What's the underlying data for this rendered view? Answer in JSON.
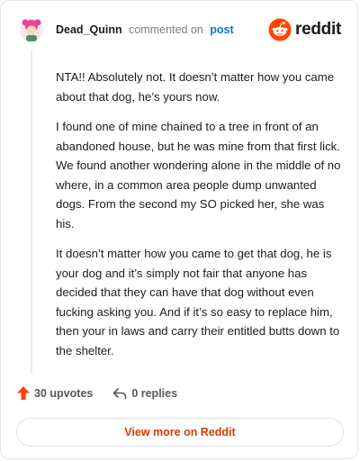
{
  "header": {
    "username": "Dead_Quinn",
    "action_text": "commented on",
    "post_link": "post"
  },
  "brand": {
    "icon": "reddit-snoo-icon",
    "wordmark": "reddit",
    "color": "#ff4500"
  },
  "comment": {
    "paragraphs": [
      "NTA!! Absolutely not. It doesn’t matter how you came about that dog, he’s yours now.",
      "I found one of mine chained to a tree in front of an abandoned house, but he was mine from that first lick. We found another wondering alone in the middle of no where, in a common area people dump unwanted dogs. From the second my SO picked her, she was his.",
      "It doesn’t matter how you came to get that dog, he is your dog and it’s simply not fair that anyone has decided that they can have that dog without even fucking asking you. And if it’s so easy to replace him, then your in laws and carry their entitled butts down to the shelter."
    ]
  },
  "stats": {
    "upvotes_label": "30 upvotes",
    "replies_label": "0 replies",
    "upvote_color": "#ff4500"
  },
  "cta": {
    "label": "View more on Reddit"
  }
}
